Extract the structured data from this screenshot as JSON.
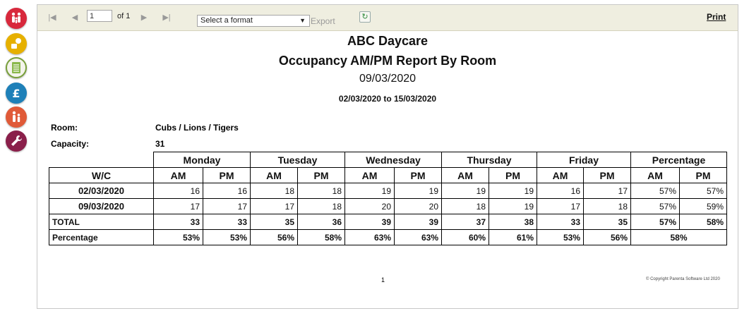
{
  "toolbar": {
    "page_value": "1",
    "of_label": "of 1",
    "format_placeholder": "Select a format",
    "export_label": "Export",
    "print_label": "Print",
    "icons": [
      "first-page-icon",
      "previous-page-icon",
      "next-page-icon",
      "last-page-icon",
      "refresh-icon"
    ]
  },
  "sidebar": {
    "items": [
      {
        "name": "family",
        "color": "#d8283c",
        "icon": "family-icon"
      },
      {
        "name": "toys",
        "color": "#e6b000",
        "icon": "blocks-icon"
      },
      {
        "name": "register",
        "color": "#78a03a",
        "icon": "notebook-icon"
      },
      {
        "name": "finance",
        "color": "#1e80b8",
        "icon": "pound-icon"
      },
      {
        "name": "staff",
        "color": "#e05a38",
        "icon": "people-icon"
      },
      {
        "name": "settings",
        "color": "#8a1f4a",
        "icon": "wrench-icon"
      }
    ]
  },
  "report": {
    "company": "ABC Daycare",
    "title": "Occupancy AM/PM Report By Room",
    "date": "09/03/2020",
    "range_from": "02/03/2020",
    "range_to_word": "to",
    "range_to": "15/03/2020",
    "room_label": "Room:",
    "room_value": "Cubs / Lions / Tigers",
    "capacity_label": "Capacity:",
    "capacity_value": "31",
    "wc_header": "W/C",
    "days": [
      "Monday",
      "Tuesday",
      "Wednesday",
      "Thursday",
      "Friday",
      "Percentage"
    ],
    "am_label": "AM",
    "pm_label": "PM",
    "weeks": [
      {
        "label": "02/03/2020",
        "values": [
          "16",
          "16",
          "18",
          "18",
          "19",
          "19",
          "19",
          "19",
          "16",
          "17",
          "57%",
          "57%"
        ]
      },
      {
        "label": "09/03/2020",
        "values": [
          "17",
          "17",
          "17",
          "18",
          "20",
          "20",
          "18",
          "19",
          "17",
          "18",
          "57%",
          "59%"
        ]
      }
    ],
    "total": {
      "label": "TOTAL",
      "values": [
        "33",
        "33",
        "35",
        "36",
        "39",
        "39",
        "37",
        "38",
        "33",
        "35",
        "57%",
        "58%"
      ]
    },
    "percentage": {
      "label": "Percentage",
      "values": [
        "53%",
        "53%",
        "56%",
        "58%",
        "63%",
        "63%",
        "60%",
        "61%",
        "53%",
        "56%"
      ],
      "overall": "58%"
    },
    "page_number": "1",
    "copyright": "© Copyright Parenta Software Ltd 2020"
  }
}
